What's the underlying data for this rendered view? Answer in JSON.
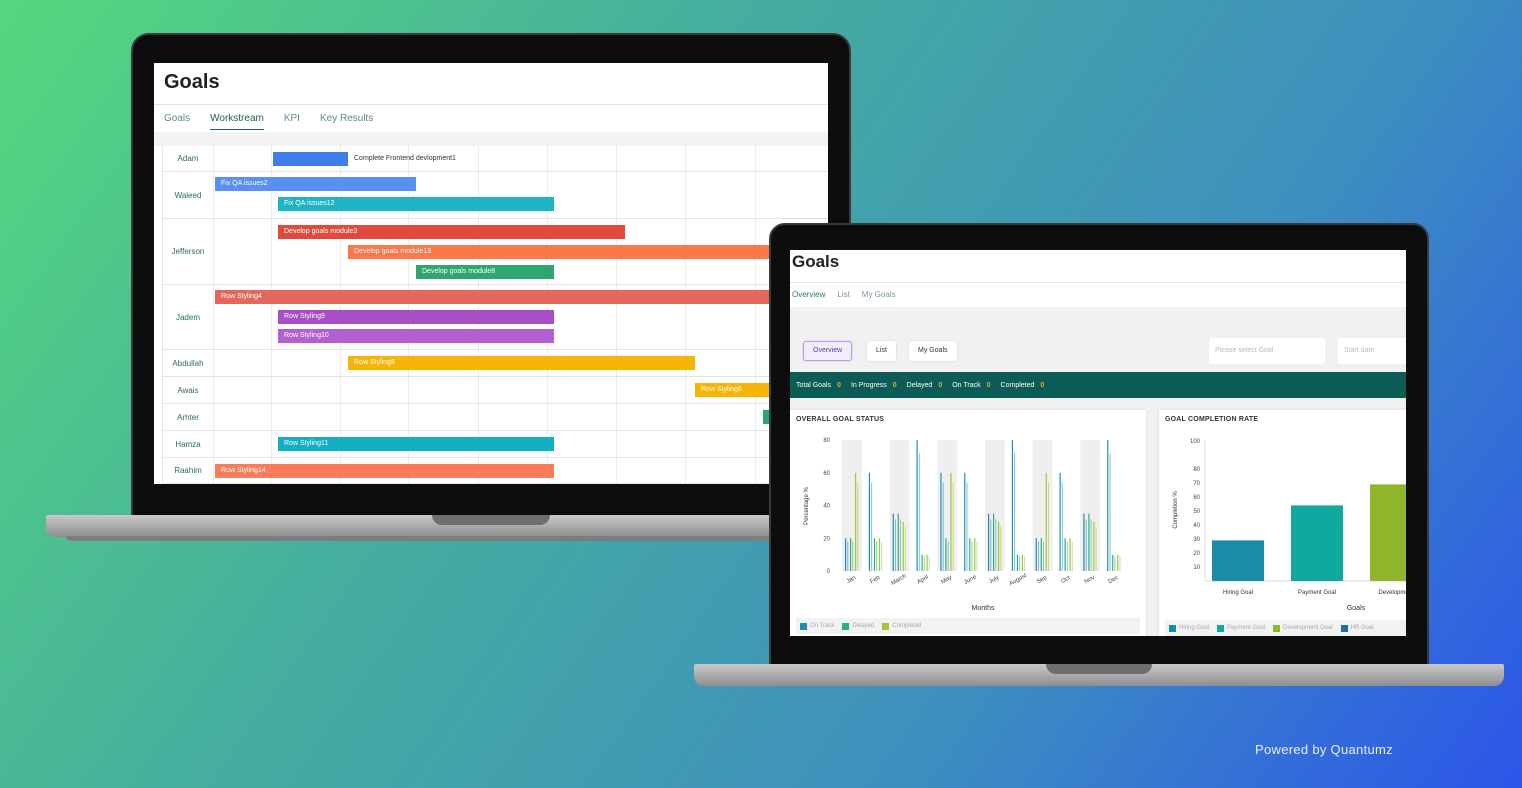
{
  "laptop1": {
    "title": "Goals",
    "tabs": [
      {
        "label": "Goals",
        "active": false
      },
      {
        "label": "Workstream",
        "active": true
      },
      {
        "label": "KPI",
        "active": false
      },
      {
        "label": "Key Results",
        "active": false
      }
    ],
    "rows": [
      {
        "name": "Adam",
        "bars": [
          {
            "label": "Complete Frontend devlopment1",
            "color": "#3f7fe9",
            "label_outside": true
          }
        ]
      },
      {
        "name": "Waleed",
        "bars": [
          {
            "label": "Fix QA issues2",
            "color": "#5b8ff0"
          },
          {
            "label": "Fix QA issues12",
            "color": "#1fb3c6"
          }
        ]
      },
      {
        "name": "Jefferson",
        "bars": [
          {
            "label": "Develop goals module3",
            "color": "#de4b3d"
          },
          {
            "label": "Develop goals module13",
            "color": "#fb7649"
          },
          {
            "label": "Develop goals module8",
            "color": "#2fa670"
          }
        ]
      },
      {
        "name": "Jadem",
        "bars": [
          {
            "label": "Row Styling4",
            "color": "#e3685b"
          },
          {
            "label": "Row Styling9",
            "color": "#a94ec5"
          },
          {
            "label": "Row Styling10",
            "color": "#b260cf"
          }
        ]
      },
      {
        "name": "Abdullah",
        "bars": [
          {
            "label": "Row Styling5",
            "color": "#f4b506"
          }
        ]
      },
      {
        "name": "Awais",
        "bars": [
          {
            "label": "Row Styling6",
            "color": "#f4b506"
          }
        ]
      },
      {
        "name": "Arhter",
        "bars": [
          {
            "label": "",
            "color": "#2fa670"
          }
        ]
      },
      {
        "name": "Hamza",
        "bars": [
          {
            "label": "Row Styling11",
            "color": "#12aec2"
          }
        ]
      },
      {
        "name": "Raahim",
        "bars": [
          {
            "label": "Row Styling14",
            "color": "#fb7b5a"
          }
        ]
      }
    ]
  },
  "laptop2": {
    "title": "Goals",
    "tabs": [
      {
        "label": "Overview",
        "active": true
      },
      {
        "label": "List",
        "active": false
      },
      {
        "label": "My Goals",
        "active": false
      }
    ],
    "view_buttons": [
      {
        "label": "Overview",
        "active": true
      },
      {
        "label": "List",
        "active": false
      },
      {
        "label": "My Goals",
        "active": false
      }
    ],
    "goal_select_placeholder": "Please select Goal",
    "start_date_placeholder": "Start date",
    "status": [
      {
        "label": "Total Goals",
        "count": "0"
      },
      {
        "label": "In Progress",
        "count": "0"
      },
      {
        "label": "Delayed",
        "count": "0"
      },
      {
        "label": "On Track",
        "count": "0"
      },
      {
        "label": "Completed",
        "count": "0"
      }
    ],
    "colors": {
      "status_bar": "#0b5c55",
      "count": "#f3a33a"
    }
  },
  "chart_data": [
    {
      "type": "bar",
      "title": "OVERALL GOAL STATUS",
      "xlabel": "Months",
      "ylabel": "Percentage %",
      "ylim": [
        0,
        80
      ],
      "yticks": [
        0,
        20,
        40,
        60,
        80
      ],
      "categories": [
        "Jan",
        "Feb",
        "March",
        "April",
        "May",
        "June",
        "July",
        "August",
        "Sep",
        "Oct",
        "Nov",
        "Dec"
      ],
      "series": [
        {
          "name": "On Track",
          "color": "#1f8fb5",
          "values": [
            20,
            60,
            35,
            80,
            60,
            60,
            35,
            80,
            20,
            60,
            35,
            80
          ]
        },
        {
          "name": "Delayed",
          "color": "#2fae84",
          "values": [
            20,
            20,
            35,
            10,
            20,
            20,
            35,
            10,
            20,
            20,
            35,
            10
          ]
        },
        {
          "name": "Completed",
          "color": "#a4c639",
          "values": [
            60,
            20,
            30,
            10,
            60,
            20,
            30,
            10,
            60,
            20,
            30,
            10
          ]
        }
      ],
      "legend": "bottom-left",
      "grid": false
    },
    {
      "type": "bar",
      "title": "GOAL COMPLETION RATE",
      "xlabel": "Goals",
      "ylabel": "Completion %",
      "ylim": [
        0,
        100
      ],
      "yticks": [
        10,
        20,
        30,
        40,
        50,
        60,
        70,
        80,
        100
      ],
      "categories": [
        "Hiring Goal",
        "Payment Goal",
        "Development"
      ],
      "values": [
        29,
        54,
        69
      ],
      "colors": [
        "#1a8ca8",
        "#10a89f",
        "#8fb52a"
      ],
      "series": [
        {
          "name": "Hiring Goal",
          "color": "#1a8ca8"
        },
        {
          "name": "Payment Goal",
          "color": "#10a89f"
        },
        {
          "name": "Development Goal",
          "color": "#8fb52a"
        },
        {
          "name": "HR Goal",
          "color": "#1d6fa8"
        }
      ],
      "legend": "bottom-left",
      "grid": false
    }
  ],
  "footer": {
    "powered_by": "Powered by Quantumz"
  }
}
